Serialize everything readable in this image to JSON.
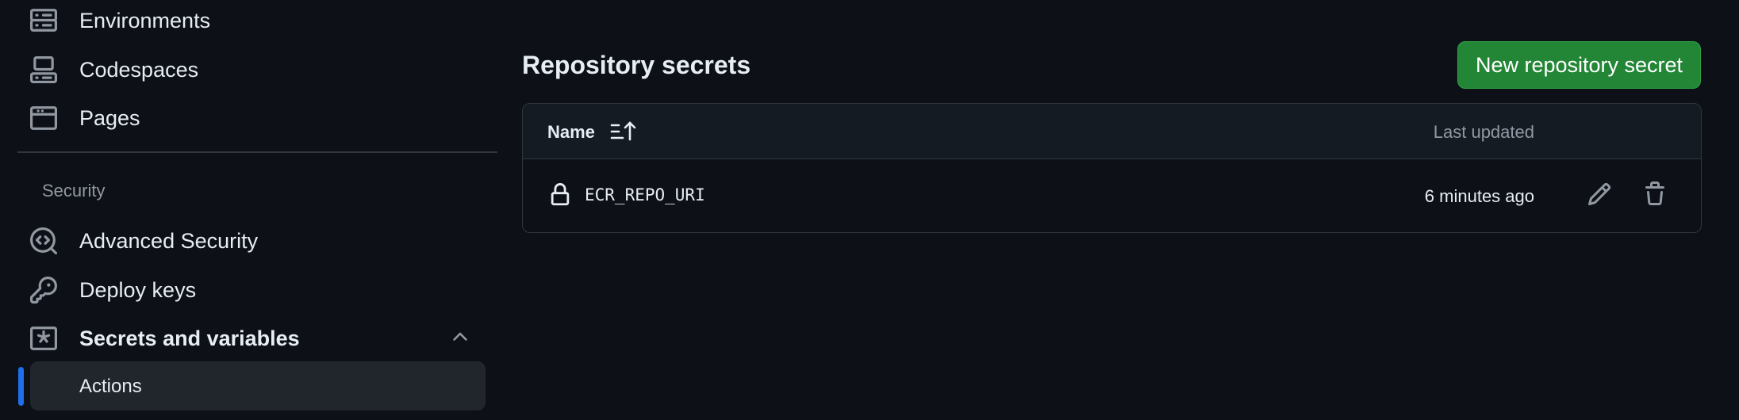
{
  "sidebar": {
    "items_top": [
      {
        "label": "Environments",
        "icon": "server-icon"
      },
      {
        "label": "Codespaces",
        "icon": "codespaces-icon"
      },
      {
        "label": "Pages",
        "icon": "browser-icon"
      }
    ],
    "security_heading": "Security",
    "items_security": [
      {
        "label": "Advanced Security",
        "icon": "codescan-icon"
      },
      {
        "label": "Deploy keys",
        "icon": "key-icon"
      },
      {
        "label": "Secrets and variables",
        "icon": "asterisk-icon"
      }
    ],
    "sub_items": [
      {
        "label": "Actions"
      }
    ]
  },
  "main": {
    "title": "Repository secrets",
    "new_button_label": "New repository secret",
    "table": {
      "headers": {
        "name": "Name",
        "last_updated": "Last updated"
      },
      "rows": [
        {
          "name": "ECR_REPO_URI",
          "last_updated": "6 minutes ago"
        }
      ]
    }
  },
  "colors": {
    "background": "#0d1117",
    "primary_button": "#238636",
    "active_indicator": "#1f6feb",
    "muted_text": "#9198a1",
    "border": "#30363d"
  }
}
